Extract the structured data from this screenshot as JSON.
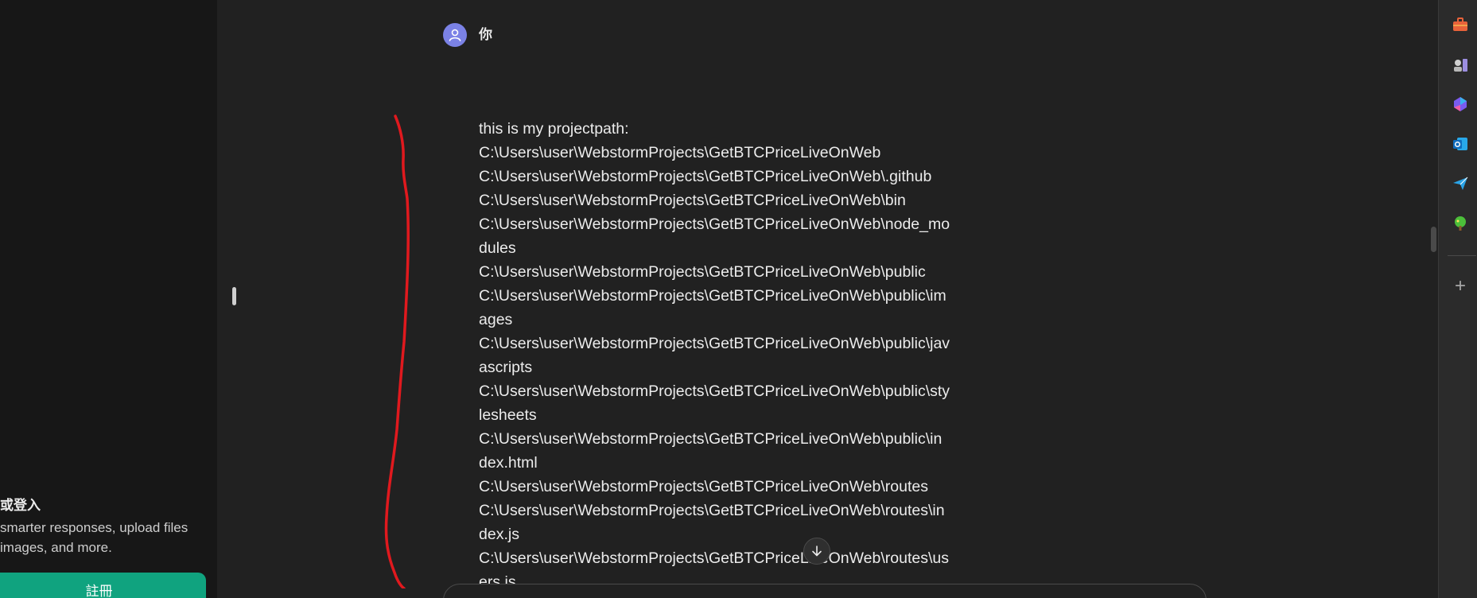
{
  "sidebar": {
    "signup_title": "或登入",
    "signup_description": "smarter responses, upload files images, and more.",
    "signup_button_label": "註冊"
  },
  "conversation": {
    "user_name": "你",
    "message_lines": [
      "this is my projectpath:",
      "C:\\Users\\user\\WebstormProjects\\GetBTCPriceLiveOnWeb",
      "C:\\Users\\user\\WebstormProjects\\GetBTCPriceLiveOnWeb\\.github",
      "C:\\Users\\user\\WebstormProjects\\GetBTCPriceLiveOnWeb\\bin",
      "C:\\Users\\user\\WebstormProjects\\GetBTCPriceLiveOnWeb\\node_mo",
      "dules",
      "C:\\Users\\user\\WebstormProjects\\GetBTCPriceLiveOnWeb\\public",
      "C:\\Users\\user\\WebstormProjects\\GetBTCPriceLiveOnWeb\\public\\im",
      "ages",
      "C:\\Users\\user\\WebstormProjects\\GetBTCPriceLiveOnWeb\\public\\jav",
      "ascripts",
      "C:\\Users\\user\\WebstormProjects\\GetBTCPriceLiveOnWeb\\public\\sty",
      "lesheets",
      "C:\\Users\\user\\WebstormProjects\\GetBTCPriceLiveOnWeb\\public\\in",
      "dex.html",
      "C:\\Users\\user\\WebstormProjects\\GetBTCPriceLiveOnWeb\\routes",
      "C:\\Users\\user\\WebstormProjects\\GetBTCPriceLiveOnWeb\\routes\\in",
      "dex.js",
      "C:\\Users\\user\\WebstormProjects\\GetBTCPriceLiveOnWeb\\routes\\us",
      "ers.js"
    ]
  },
  "edge_bar": {
    "icons": [
      "briefcase-icon",
      "chess-icon",
      "copilot-icon",
      "outlook-icon",
      "send-icon",
      "tree-icon",
      "plus-icon"
    ],
    "plus_label": "+"
  },
  "colors": {
    "background": "#212121",
    "sidebar": "#171717",
    "accent": "#10a37f",
    "annotation": "#e0191e",
    "avatar": "#7b82e6"
  }
}
